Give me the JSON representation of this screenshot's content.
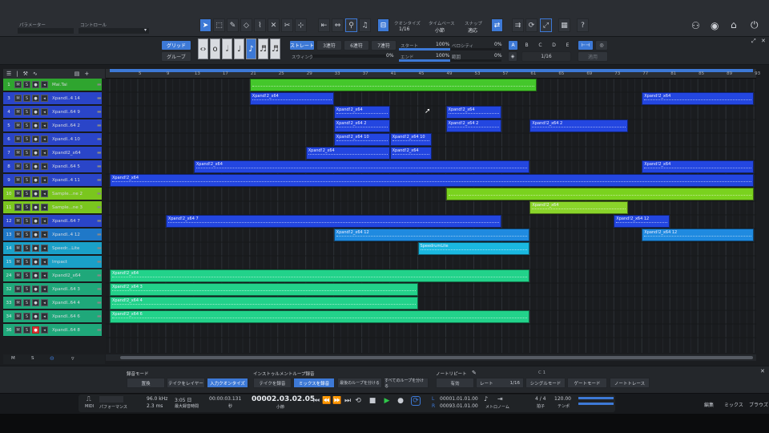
{
  "topbar": {
    "param_label": "パラメーター",
    "control_label": "コントロール",
    "quantize_label": "クオンタイズ",
    "quantize_value": "1/16",
    "timebase_label": "タイムベース",
    "timebase_value": "小節",
    "snap_label": "スナップ",
    "snap_value": "適応",
    "help": "?"
  },
  "quant_panel": {
    "grid": "グリッド",
    "groove": "グルーブ",
    "straight": "ストレート",
    "triplet3": "3連符",
    "triplet6": "6連符",
    "tuplet7": "7連符",
    "swing_label": "スウィング",
    "swing_value": "0%",
    "start_label": "スタート",
    "start_value": "100%",
    "velocity_label": "ベロシティ",
    "velocity_value": "0%",
    "end_label": "エンド",
    "end_value": "100%",
    "range_label": "範囲",
    "range_value": "0%",
    "letters": [
      "A",
      "B",
      "C",
      "D",
      "E"
    ],
    "subdiv": "1/16",
    "apply": "適用"
  },
  "ruler": {
    "marks": [
      "5",
      "9",
      "13",
      "17",
      "21",
      "25",
      "29",
      "33",
      "37",
      "41",
      "45",
      "49",
      "53",
      "57",
      "61",
      "65",
      "69",
      "73",
      "77",
      "81",
      "85",
      "89",
      "93"
    ]
  },
  "track_header": {
    "m": "M",
    "s": "S"
  },
  "tracks": [
    {
      "num": "1",
      "name": "Mai.Tai",
      "color": "#2fa52f",
      "rec": false
    },
    {
      "num": "3",
      "name": "Xpandl..4 14",
      "color": "#2a45c8",
      "rec": false
    },
    {
      "num": "4",
      "name": "Xpandl..64 9",
      "color": "#2a45c8",
      "rec": false
    },
    {
      "num": "5",
      "name": "Xpandl..64 2",
      "color": "#2a45c8",
      "rec": false
    },
    {
      "num": "6",
      "name": "Xpandl..4 10",
      "color": "#2a45c8",
      "rec": false
    },
    {
      "num": "7",
      "name": "XpandI2_x64",
      "color": "#2a45c8",
      "rec": false
    },
    {
      "num": "8",
      "name": "Xpandl..64 5",
      "color": "#2a45c8",
      "rec": false
    },
    {
      "num": "9",
      "name": "Xpandl..4 11",
      "color": "#2a45c8",
      "rec": false
    },
    {
      "num": "10",
      "name": "Sample...ne 2",
      "color": "#7ac61e",
      "rec": false
    },
    {
      "num": "11",
      "name": "Sample...ne 3",
      "color": "#7ac61e",
      "rec": false
    },
    {
      "num": "12",
      "name": "Xpandl..64 7",
      "color": "#2a45c8",
      "rec": false
    },
    {
      "num": "13",
      "name": "Xpandl..4 12",
      "color": "#1f78c8",
      "rec": false
    },
    {
      "num": "14",
      "name": "Speedr...Lite",
      "color": "#1aa0c8",
      "rec": false
    },
    {
      "num": "15",
      "name": "Impact",
      "color": "#1aa0c8",
      "rec": false
    },
    {
      "num": "24",
      "name": "XpandI2_x64",
      "color": "#1fa87a",
      "rec": false
    },
    {
      "num": "32",
      "name": "Xpandl..64 3",
      "color": "#1fa87a",
      "rec": false
    },
    {
      "num": "33",
      "name": "Xpandl..64 4",
      "color": "#1fa87a",
      "rec": false
    },
    {
      "num": "34",
      "name": "Xpandl..64 6",
      "color": "#1fa87a",
      "rec": false
    },
    {
      "num": "36",
      "name": "Xpandl..64 8",
      "color": "#1fa87a",
      "rec": true
    }
  ],
  "clips": [
    {
      "row": 0,
      "start": 21,
      "end": 62,
      "label": "",
      "color": "#44c72b"
    },
    {
      "row": 1,
      "start": 21,
      "end": 33,
      "label": "Xpand!2_x64",
      "color": "#2346e0"
    },
    {
      "row": 1,
      "start": 77,
      "end": 93,
      "label": "Xpand!2_x64",
      "color": "#2346e0"
    },
    {
      "row": 2,
      "start": 33,
      "end": 41,
      "label": "Xpand!2_x64",
      "color": "#2346e0"
    },
    {
      "row": 2,
      "start": 49,
      "end": 57,
      "label": "Xpand!2_x64",
      "color": "#2346e0"
    },
    {
      "row": 3,
      "start": 33,
      "end": 41,
      "label": "Xpand!2_x64 2",
      "color": "#2346e0"
    },
    {
      "row": 3,
      "start": 49,
      "end": 57,
      "label": "Xpand!2_x64 2",
      "color": "#2346e0"
    },
    {
      "row": 3,
      "start": 61,
      "end": 75,
      "label": "Xpand!2_x64 2",
      "color": "#2346e0"
    },
    {
      "row": 4,
      "start": 33,
      "end": 41,
      "label": "Xpand!2_x64 10",
      "color": "#2346e0"
    },
    {
      "row": 4,
      "start": 41,
      "end": 47,
      "label": "Xpand!2_x64 10",
      "color": "#2346e0"
    },
    {
      "row": 5,
      "start": 29,
      "end": 41,
      "label": "Xpand!2_x64",
      "color": "#2346e0"
    },
    {
      "row": 5,
      "start": 41,
      "end": 47,
      "label": "Xpand!2_x64",
      "color": "#2346e0"
    },
    {
      "row": 6,
      "start": 13,
      "end": 61,
      "label": "Xpand!2_x64",
      "color": "#2346e0"
    },
    {
      "row": 6,
      "start": 77,
      "end": 93,
      "label": "Xpand!2_x64",
      "color": "#2346e0"
    },
    {
      "row": 7,
      "start": 1,
      "end": 93,
      "label": "Xpand!2_x64",
      "color": "#2346e0"
    },
    {
      "row": 8,
      "start": 49,
      "end": 93,
      "label": "",
      "color": "#7ad21e"
    },
    {
      "row": 9,
      "start": 61,
      "end": 75,
      "label": "Xpand!2_x64",
      "color": "#8ad42a"
    },
    {
      "row": 10,
      "start": 9,
      "end": 57,
      "label": "Xpand!2_x64 7",
      "color": "#2346e0"
    },
    {
      "row": 10,
      "start": 73,
      "end": 81,
      "label": "Xpand!2_x64 12",
      "color": "#2346e0"
    },
    {
      "row": 11,
      "start": 33,
      "end": 61,
      "label": "Xpand!2_x64 12",
      "color": "#1f8ae0"
    },
    {
      "row": 11,
      "start": 77,
      "end": 93,
      "label": "Xpand!2_x64 12",
      "color": "#1f8ae0"
    },
    {
      "row": 12,
      "start": 45,
      "end": 61,
      "label": "SpeedrumLite",
      "color": "#1ab8e0"
    },
    {
      "row": 14,
      "start": 1,
      "end": 61,
      "label": "Xpand!2_x64",
      "color": "#22d28a"
    },
    {
      "row": 15,
      "start": 1,
      "end": 45,
      "label": "Xpand!2_x64 3",
      "color": "#22d28a"
    },
    {
      "row": 16,
      "start": 1,
      "end": 45,
      "label": "Xpand!2_x64 4",
      "color": "#22d28a"
    },
    {
      "row": 17,
      "start": 1,
      "end": 61,
      "label": "Xpand!2_x64 6",
      "color": "#22d28a"
    }
  ],
  "foot": {
    "m": "M",
    "s": "S"
  },
  "rec_panel": {
    "rec_mode_label": "録音モード",
    "replace": "置換",
    "take_layer": "テイクをレイヤー",
    "input_quant": "入力クオンタイズ",
    "instr_loop_label": "インストゥルメントループ録音",
    "record_take": "テイクを録音",
    "mix_record": "ミックスを録音",
    "last_loop_sep": "最後のループを分ける",
    "all_loops_sep": "すべてのループを分ける",
    "note_repeat_label": "ノートリピート",
    "enable": "有効",
    "rate": "レート",
    "rate_value": "1/16",
    "single_mode": "シングルモード",
    "gate_mode": "ゲートモード",
    "note_release": "ノートトレース",
    "c1": "C 1"
  },
  "transport": {
    "midi": "MIDI",
    "perf": "パフォーマンス",
    "sample_rate": "96.0 kHz",
    "latency": "2.3 ms",
    "rec_time": "3:05 日",
    "rec_time_label": "最大録音時間",
    "seconds": "00:00:03.131",
    "seconds_label": "秒",
    "position": "00002.03.02.05",
    "position_label": "小節",
    "loop_start": "00001.01.01.00",
    "loop_end": "00093.01.01.00",
    "metronome_label": "メトロノーム",
    "time_sig": "4 / 4",
    "time_sig_label": "拍子",
    "tempo": "120.00",
    "tempo_label": "テンポ",
    "edit": "編集",
    "mix": "ミックス",
    "browse": "ブラウズ"
  }
}
